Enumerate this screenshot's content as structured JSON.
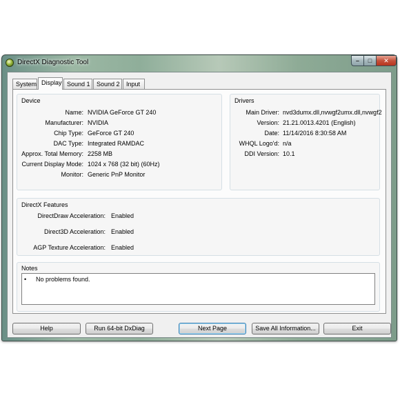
{
  "window": {
    "title": "DirectX Diagnostic Tool",
    "icons": {
      "app": "directx-icon",
      "minimize": "minimize-icon",
      "maximize": "maximize-icon",
      "close": "close-icon"
    }
  },
  "tabs": [
    {
      "label": "System",
      "active": false
    },
    {
      "label": "Display",
      "active": true
    },
    {
      "label": "Sound 1",
      "active": false
    },
    {
      "label": "Sound 2",
      "active": false
    },
    {
      "label": "Input",
      "active": false
    }
  ],
  "device": {
    "title": "Device",
    "rows": [
      {
        "label": "Name:",
        "value": "NVIDIA GeForce GT 240"
      },
      {
        "label": "Manufacturer:",
        "value": "NVIDIA"
      },
      {
        "label": "Chip Type:",
        "value": "GeForce GT 240"
      },
      {
        "label": "DAC Type:",
        "value": "Integrated RAMDAC"
      },
      {
        "label": "Approx. Total Memory:",
        "value": "2258 MB"
      },
      {
        "label": "Current Display Mode:",
        "value": "1024 x 768 (32 bit) (60Hz)"
      },
      {
        "label": "Monitor:",
        "value": "Generic PnP Monitor"
      }
    ]
  },
  "drivers": {
    "title": "Drivers",
    "rows": [
      {
        "label": "Main Driver:",
        "value": "nvd3dumx.dll,nvwgf2umx.dll,nvwgf2"
      },
      {
        "label": "Version:",
        "value": "21.21.0013.4201 (English)"
      },
      {
        "label": "Date:",
        "value": "11/14/2016 8:30:58 AM"
      },
      {
        "label": "WHQL Logo'd:",
        "value": "n/a"
      },
      {
        "label": "DDI Version:",
        "value": "10.1"
      }
    ]
  },
  "features": {
    "title": "DirectX Features",
    "rows": [
      {
        "label": "DirectDraw Acceleration:",
        "value": "Enabled"
      },
      {
        "label": "Direct3D Acceleration:",
        "value": "Enabled"
      },
      {
        "label": "AGP Texture Acceleration:",
        "value": "Enabled"
      }
    ]
  },
  "notes": {
    "title": "Notes",
    "bullet": "•",
    "text": "No problems found."
  },
  "buttons": {
    "help": "Help",
    "run64": "Run 64-bit DxDiag",
    "next": "Next Page",
    "save": "Save All Information...",
    "exit": "Exit"
  }
}
